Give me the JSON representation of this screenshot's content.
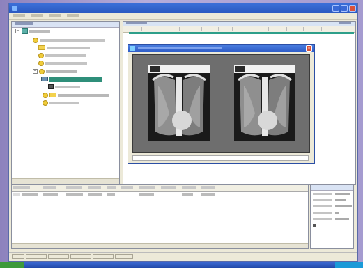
{
  "window": {
    "title": ""
  },
  "tree": {
    "root_label": ""
  },
  "viewer": {
    "status": "",
    "images": [
      {
        "overlay": ""
      },
      {
        "overlay": ""
      }
    ]
  },
  "results": {
    "columns": [
      "",
      "",
      "",
      "",
      "",
      "",
      "",
      "",
      "",
      "",
      ""
    ],
    "rows": [
      [
        "",
        "",
        "",
        "",
        "",
        "",
        "",
        "",
        "",
        "",
        ""
      ]
    ]
  },
  "properties": {
    "rows": []
  },
  "statusbar": {
    "segments": [
      "",
      "",
      "",
      "",
      "",
      ""
    ]
  },
  "colors": {
    "accent": "#2f8f7a",
    "titlebar": "#2a58c0",
    "close": "#d9523a",
    "folder": "#f3d24e"
  },
  "icons": [
    "folder-icon",
    "study-icon",
    "xray-image-icon",
    "close-icon"
  ]
}
